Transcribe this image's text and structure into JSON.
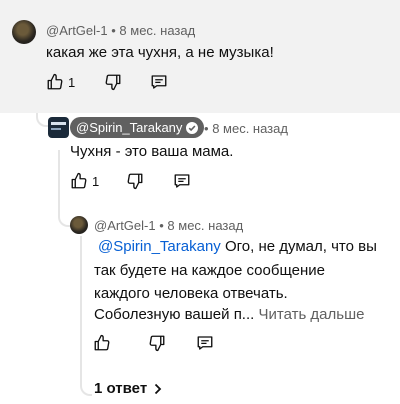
{
  "comments": [
    {
      "author": "@ArtGel-1",
      "time": "8 мес. назад",
      "text": "какая же эта чухня, а не музыка!",
      "likes": "1"
    },
    {
      "author": "@Spirin_Tarakany",
      "time": "8 мес. назад",
      "verified": true,
      "text": "Чухня - это ваша мама.",
      "likes": "1"
    },
    {
      "author": "@ArtGel-1",
      "time": "8 мес. назад",
      "mention": "@Spirin_Tarakany",
      "text_lines": [
        "Ого, не думал, что вы",
        "так будете на каждое сообщение",
        "каждого человека отвечать.",
        "Соболезную вашей п..."
      ],
      "read_more": "Читать дальше"
    }
  ],
  "separator": "•",
  "replies_label": "1 ответ",
  "colors": {
    "highlight_bg": "#f2f2f2",
    "mention": "#065fd4",
    "meta": "#606060",
    "chip_bg": "#606060"
  },
  "icons": [
    "like-icon",
    "dislike-icon",
    "reply-icon",
    "verified-icon",
    "chevron-right-icon"
  ]
}
